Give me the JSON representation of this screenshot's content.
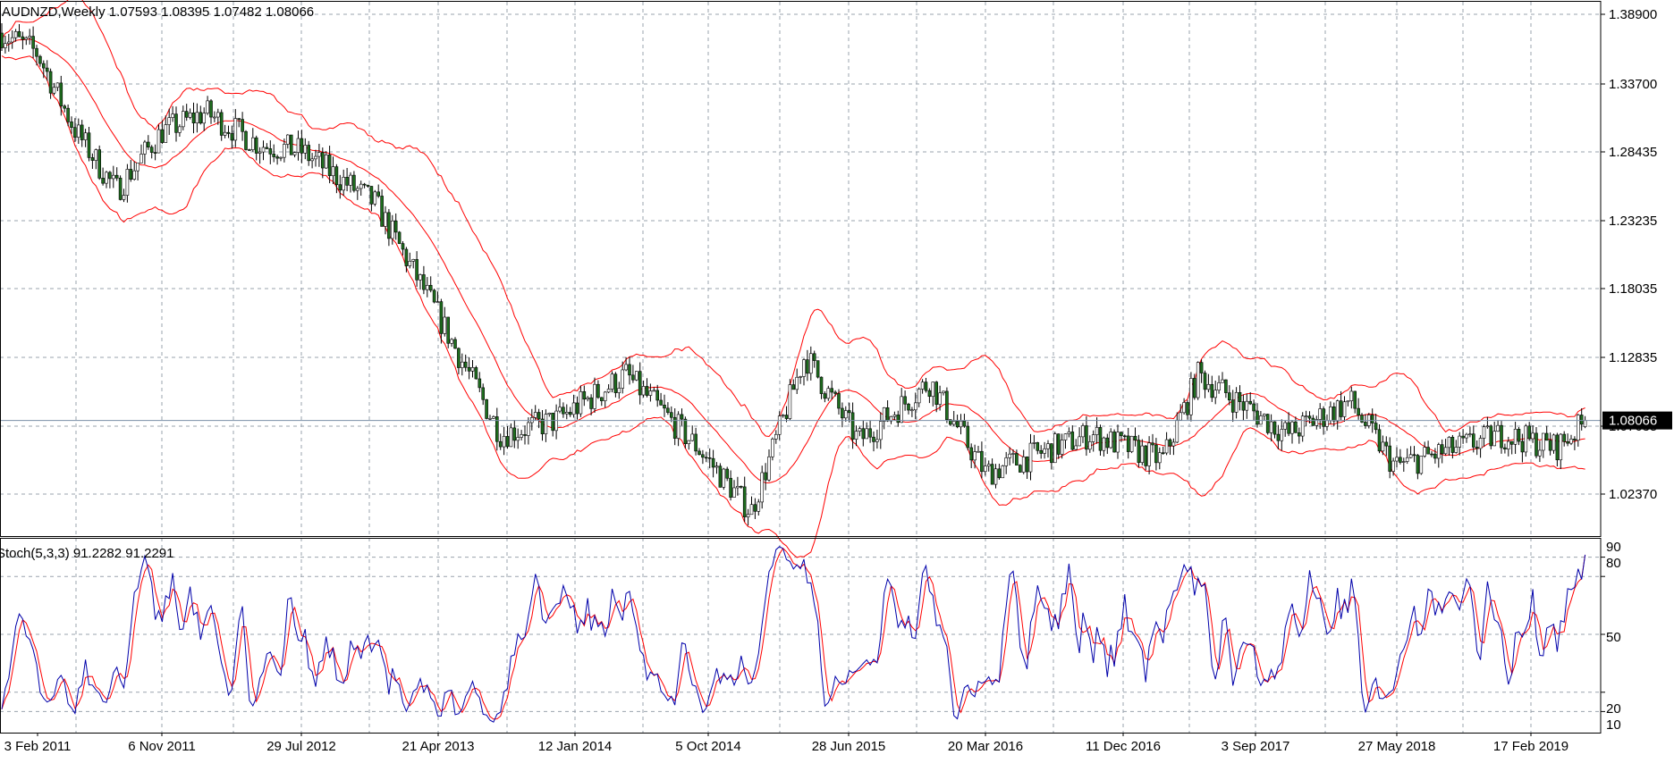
{
  "header": {
    "symbol_line": "AUDNZD,Weekly  1.07593 1.08395 1.07482 1.08066",
    "indicator_line": "Stoch(5,3,3) 91.2282 91.2291"
  },
  "colors": {
    "background": "#ffffff",
    "grid": "#9aa3ad",
    "candle_up": "#000000",
    "candle_down_body": "#1e6e1e",
    "bollinger": "#ff0000",
    "stoch_main": "#0000aa",
    "stoch_signal": "#ff0000",
    "price_line": "#7a8ea6",
    "price_label_bg": "#000000",
    "price_label_text": "#ffffff"
  },
  "chart_data": [
    {
      "type": "candlestick",
      "symbol": "AUDNZD",
      "timeframe": "Weekly",
      "ohlc_last": {
        "open": 1.07593,
        "high": 1.08395,
        "low": 1.07482,
        "close": 1.08066
      },
      "current_price_label": "1.08066",
      "y_ticks": [
        "1.38900",
        "1.33700",
        "1.28435",
        "1.23235",
        "1.18035",
        "1.12835",
        "1.07635",
        "1.02370"
      ],
      "ylim": [
        1.0,
        1.4
      ],
      "x_ticks": [
        "3 Feb 2011",
        "6 Nov 2011",
        "29 Jul 2012",
        "21 Apr 2013",
        "12 Jan 2014",
        "5 Oct 2014",
        "28 Jun 2015",
        "20 Mar 2016",
        "11 Dec 2016",
        "3 Sep 2017",
        "27 May 2018",
        "17 Feb 2019"
      ],
      "close_path_approx": [
        [
          "3 Feb 2011",
          1.375
        ],
        [
          "Jun 2011",
          1.3
        ],
        [
          "Sep 2011",
          1.255
        ],
        [
          "6 Nov 2011",
          1.3
        ],
        [
          "Jan 2012",
          1.31
        ],
        [
          "Apr 2012",
          1.28
        ],
        [
          "29 Jul 2012",
          1.28
        ],
        [
          "Dec 2012",
          1.25
        ],
        [
          "21 Apr 2013",
          1.16
        ],
        [
          "Aug 2013",
          1.07
        ],
        [
          "12 Jan 2014",
          1.08
        ],
        [
          "Jun 2014",
          1.115
        ],
        [
          "5 Oct 2014",
          1.06
        ],
        [
          "Jan 2015",
          1.01
        ],
        [
          "28 Jun 2015",
          1.13
        ],
        [
          "Sep 2015",
          1.065
        ],
        [
          "20 Mar 2016",
          1.11
        ],
        [
          "Jun 2016",
          1.04
        ],
        [
          "11 Dec 2016",
          1.07
        ],
        [
          "Mar 2017",
          1.05
        ],
        [
          "3 Sep 2017",
          1.115
        ],
        [
          "Feb 2018",
          1.07
        ],
        [
          "27 May 2018",
          1.095
        ],
        [
          "Nov 2018",
          1.045
        ],
        [
          "17 Feb 2019",
          1.07
        ],
        [
          "Jun 2019",
          1.06
        ],
        [
          "Aug 2019",
          1.08066
        ]
      ],
      "overlay": "Bollinger Bands"
    },
    {
      "type": "line",
      "indicator": "Stochastic",
      "title": "Stoch(5,3,3)",
      "main_value": 91.2282,
      "signal_value": 91.2291,
      "y_ticks": [
        "90",
        "80",
        "50",
        "20",
        "10"
      ],
      "ylim": [
        0,
        100
      ],
      "series": [
        {
          "name": "main",
          "color": "#0000aa"
        },
        {
          "name": "signal",
          "color": "#ff0000"
        }
      ]
    }
  ]
}
